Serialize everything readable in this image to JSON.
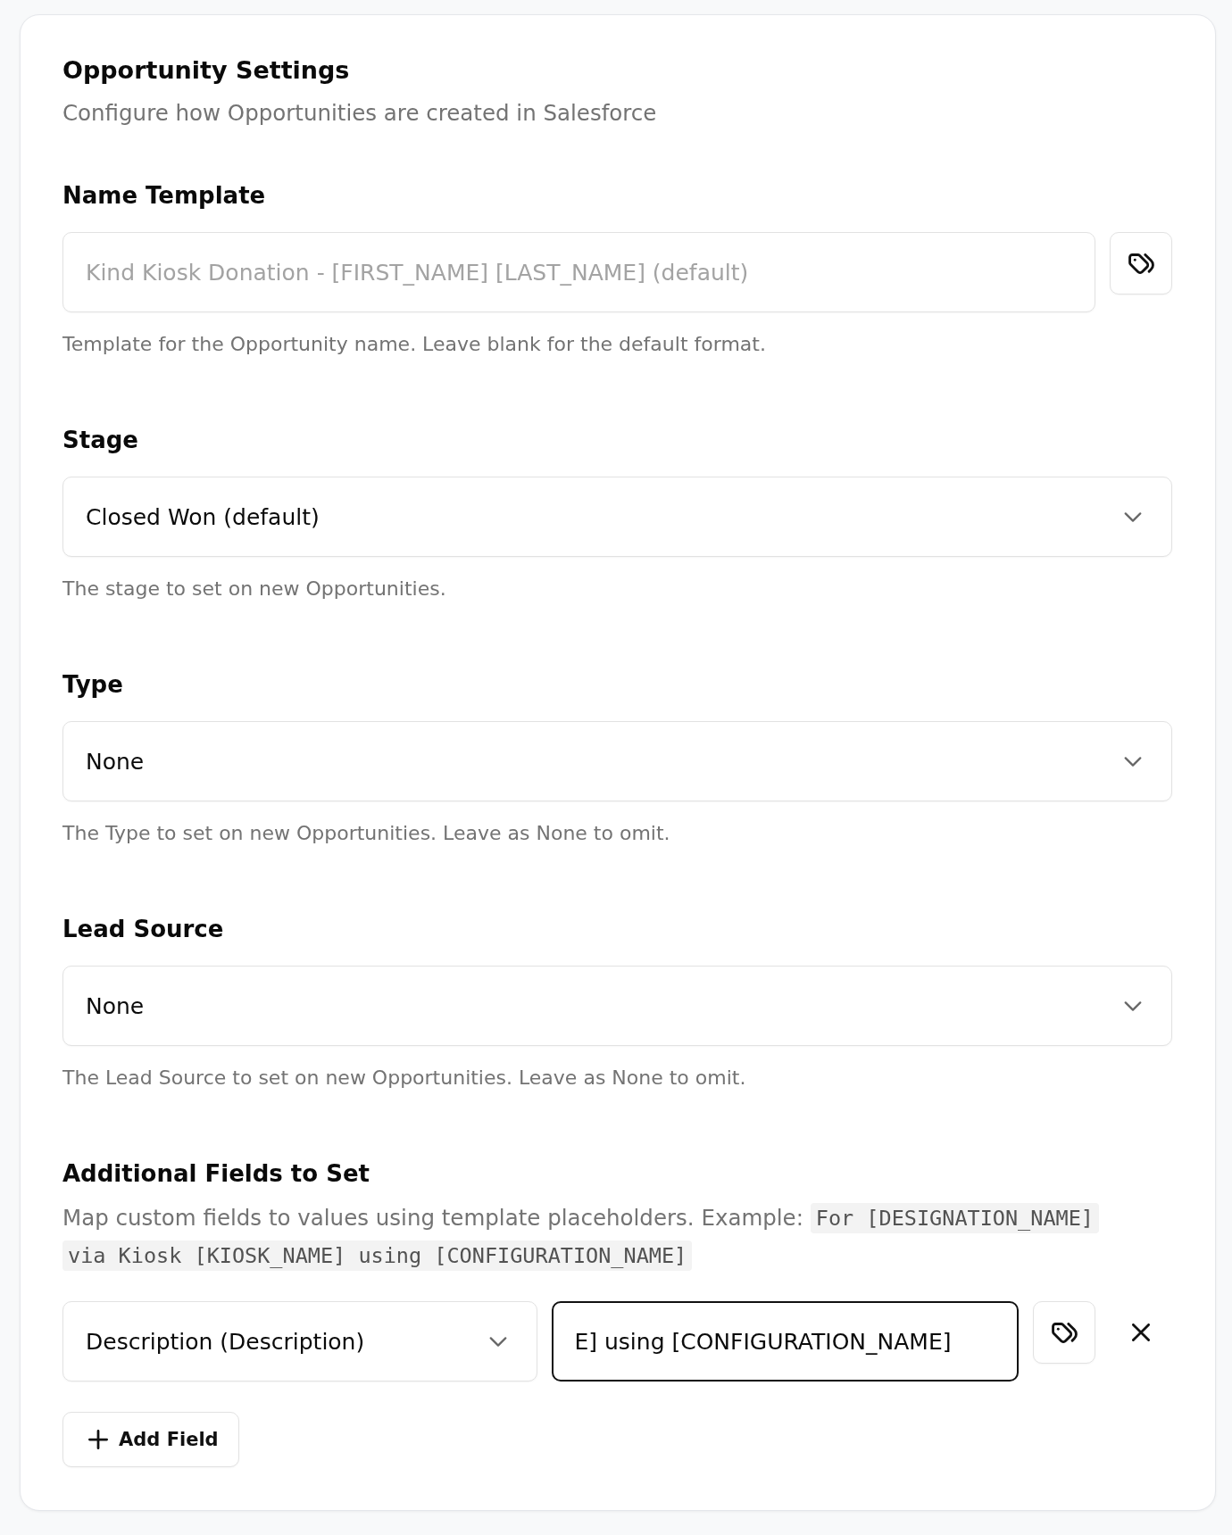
{
  "card": {
    "title": "Opportunity Settings",
    "subtitle": "Configure how Opportunities are created in Salesforce"
  },
  "fields": [
    {
      "kind": "text",
      "label": "Name Template",
      "placeholder": "Kind Kiosk Donation - [FIRST_NAME] [LAST_NAME] (default)",
      "help": "Template for the Opportunity name. Leave blank for the default format."
    },
    {
      "kind": "select",
      "label": "Stage",
      "value": "Closed Won (default)",
      "help": "The stage to set on new Opportunities."
    },
    {
      "kind": "select",
      "label": "Type",
      "value": "None",
      "help": "The Type to set on new Opportunities. Leave as None to omit."
    },
    {
      "kind": "select",
      "label": "Lead Source",
      "value": "None",
      "help": "The Lead Source to set on new Opportunities. Leave as None to omit."
    }
  ],
  "additional_fields": {
    "label": "Additional Fields to Set",
    "description": "Map custom fields to values using template placeholders. Example:",
    "example": "For [DESIGNATION_NAME] via Kiosk [KIOSK_NAME] using [CONFIGURATION_NAME]",
    "rows": [
      {
        "field": "Description (Description)",
        "value": "E] using [CONFIGURATION_NAME]",
        "focused": true
      }
    ],
    "add_button": "Add Field"
  }
}
